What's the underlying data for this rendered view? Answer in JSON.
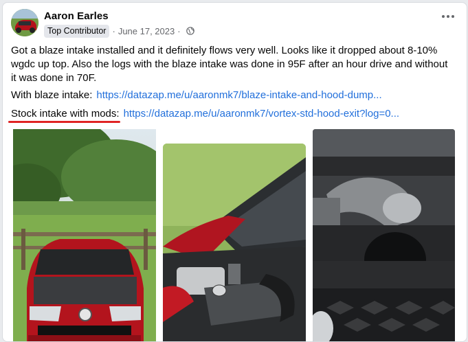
{
  "post": {
    "author": "Aaron Earles",
    "badge": "Top Contributor",
    "separator": "·",
    "date": "June 17, 2023",
    "privacy_icon": "globe-icon",
    "more_icon": "more-options-icon",
    "text": "Got a blaze intake installed and it definitely flows very well. Looks like it dropped about 8-10% wgdc up top. Also the logs with the blaze intake was done in 95F after an hour drive and without it was done in 70F.",
    "links": [
      {
        "label": "With blaze intake:",
        "url": "https://datazap.me/u/aaronmk7/blaze-intake-and-hood-dump..."
      },
      {
        "label": "Stock intake with mods:",
        "url": "https://datazap.me/u/aaronmk7/vortex-std-hood-exit?log=0..."
      }
    ]
  },
  "photos": [
    {
      "name": "red-gti-front-photo"
    },
    {
      "name": "engine-bay-tsi-photo"
    },
    {
      "name": "intake-closeup-photo"
    }
  ],
  "colors": {
    "link": "#216fdb",
    "annotation": "#e02424",
    "badge_bg": "#e4e6eb"
  }
}
